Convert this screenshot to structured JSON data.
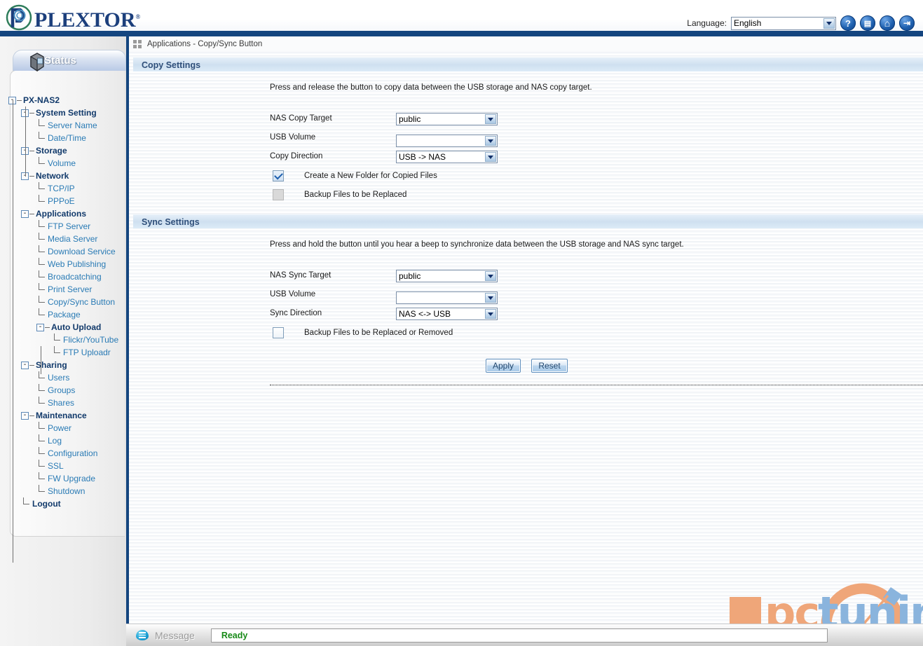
{
  "header": {
    "brand": "PLEXTOR",
    "brand_reg": "®",
    "language_label": "Language:",
    "language_value": "English",
    "icons": [
      {
        "name": "help-icon",
        "glyph": "?"
      },
      {
        "name": "sitemap-icon",
        "glyph": "▤"
      },
      {
        "name": "home-icon",
        "glyph": "⌂"
      },
      {
        "name": "logout-icon",
        "glyph": "⇥"
      }
    ]
  },
  "sidebar": {
    "tab_label": "Status",
    "tree": [
      {
        "label": "PX-NAS2",
        "level": 0,
        "type": "parent",
        "expander": "-"
      },
      {
        "label": "System Setting",
        "level": 1,
        "type": "parent",
        "expander": "-"
      },
      {
        "label": "Server Name",
        "level": 2,
        "type": "leaf"
      },
      {
        "label": "Date/Time",
        "level": 2,
        "type": "leaf"
      },
      {
        "label": "Storage",
        "level": 1,
        "type": "parent",
        "expander": "-"
      },
      {
        "label": "Volume",
        "level": 2,
        "type": "leaf"
      },
      {
        "label": "Network",
        "level": 1,
        "type": "parent",
        "expander": "-"
      },
      {
        "label": "TCP/IP",
        "level": 2,
        "type": "leaf"
      },
      {
        "label": "PPPoE",
        "level": 2,
        "type": "leaf"
      },
      {
        "label": "Applications",
        "level": 1,
        "type": "parent",
        "expander": "-"
      },
      {
        "label": "FTP Server",
        "level": 2,
        "type": "leaf"
      },
      {
        "label": "Media Server",
        "level": 2,
        "type": "leaf"
      },
      {
        "label": "Download Service",
        "level": 2,
        "type": "leaf"
      },
      {
        "label": "Web Publishing",
        "level": 2,
        "type": "leaf"
      },
      {
        "label": "Broadcatching",
        "level": 2,
        "type": "leaf"
      },
      {
        "label": "Print Server",
        "level": 2,
        "type": "leaf"
      },
      {
        "label": "Copy/Sync Button",
        "level": 2,
        "type": "leaf"
      },
      {
        "label": "Package",
        "level": 2,
        "type": "leaf"
      },
      {
        "label": "Auto Upload",
        "level": 2,
        "type": "parent",
        "expander": "-"
      },
      {
        "label": "Flickr/YouTube",
        "level": 3,
        "type": "leaf"
      },
      {
        "label": "FTP Uploadr",
        "level": 3,
        "type": "leaf"
      },
      {
        "label": "Sharing",
        "level": 1,
        "type": "parent",
        "expander": "-"
      },
      {
        "label": "Users",
        "level": 2,
        "type": "leaf"
      },
      {
        "label": "Groups",
        "level": 2,
        "type": "leaf"
      },
      {
        "label": "Shares",
        "level": 2,
        "type": "leaf"
      },
      {
        "label": "Maintenance",
        "level": 1,
        "type": "parent",
        "expander": "-"
      },
      {
        "label": "Power",
        "level": 2,
        "type": "leaf"
      },
      {
        "label": "Log",
        "level": 2,
        "type": "leaf"
      },
      {
        "label": "Configuration",
        "level": 2,
        "type": "leaf"
      },
      {
        "label": "SSL",
        "level": 2,
        "type": "leaf"
      },
      {
        "label": "FW Upgrade",
        "level": 2,
        "type": "leaf"
      },
      {
        "label": "Shutdown",
        "level": 2,
        "type": "leaf"
      },
      {
        "label": "Logout",
        "level": 1,
        "type": "parent-plain"
      }
    ]
  },
  "breadcrumb": "Applications - Copy/Sync Button",
  "copy_settings": {
    "title": "Copy Settings",
    "description": "Press and release the button to copy data between the USB storage and NAS copy target.",
    "nas_copy_target_label": "NAS Copy Target",
    "nas_copy_target_value": "public",
    "usb_volume_label": "USB Volume",
    "usb_volume_value": "",
    "copy_direction_label": "Copy Direction",
    "copy_direction_value": "USB -> NAS",
    "create_folder_label": "Create a New Folder for Copied Files",
    "backup_replaced_label": "Backup Files to be Replaced"
  },
  "sync_settings": {
    "title": "Sync Settings",
    "description": "Press and hold the button until you hear a beep to synchronize data between the USB storage and NAS sync target.",
    "nas_sync_target_label": "NAS Sync Target",
    "nas_sync_target_value": "public",
    "usb_volume_label": "USB Volume",
    "usb_volume_value": "",
    "sync_direction_label": "Sync Direction",
    "sync_direction_value": "NAS <-> USB",
    "backup_replaced_removed_label": "Backup Files to be Replaced or Removed"
  },
  "actions": {
    "apply_label": "Apply",
    "reset_label": "Reset"
  },
  "footer": {
    "message_label": "Message",
    "status_text": "Ready"
  },
  "watermark": {
    "text_pc": "pc",
    "text_tuning": "tuning"
  },
  "colors": {
    "navy": "#14457f",
    "link_blue": "#2a7bb5",
    "parent_blue": "#123a6b",
    "section_bg": "#cfe0f0",
    "status_green": "#178a17",
    "wm_orange": "#efa679",
    "wm_blue": "#8ab4dd"
  }
}
